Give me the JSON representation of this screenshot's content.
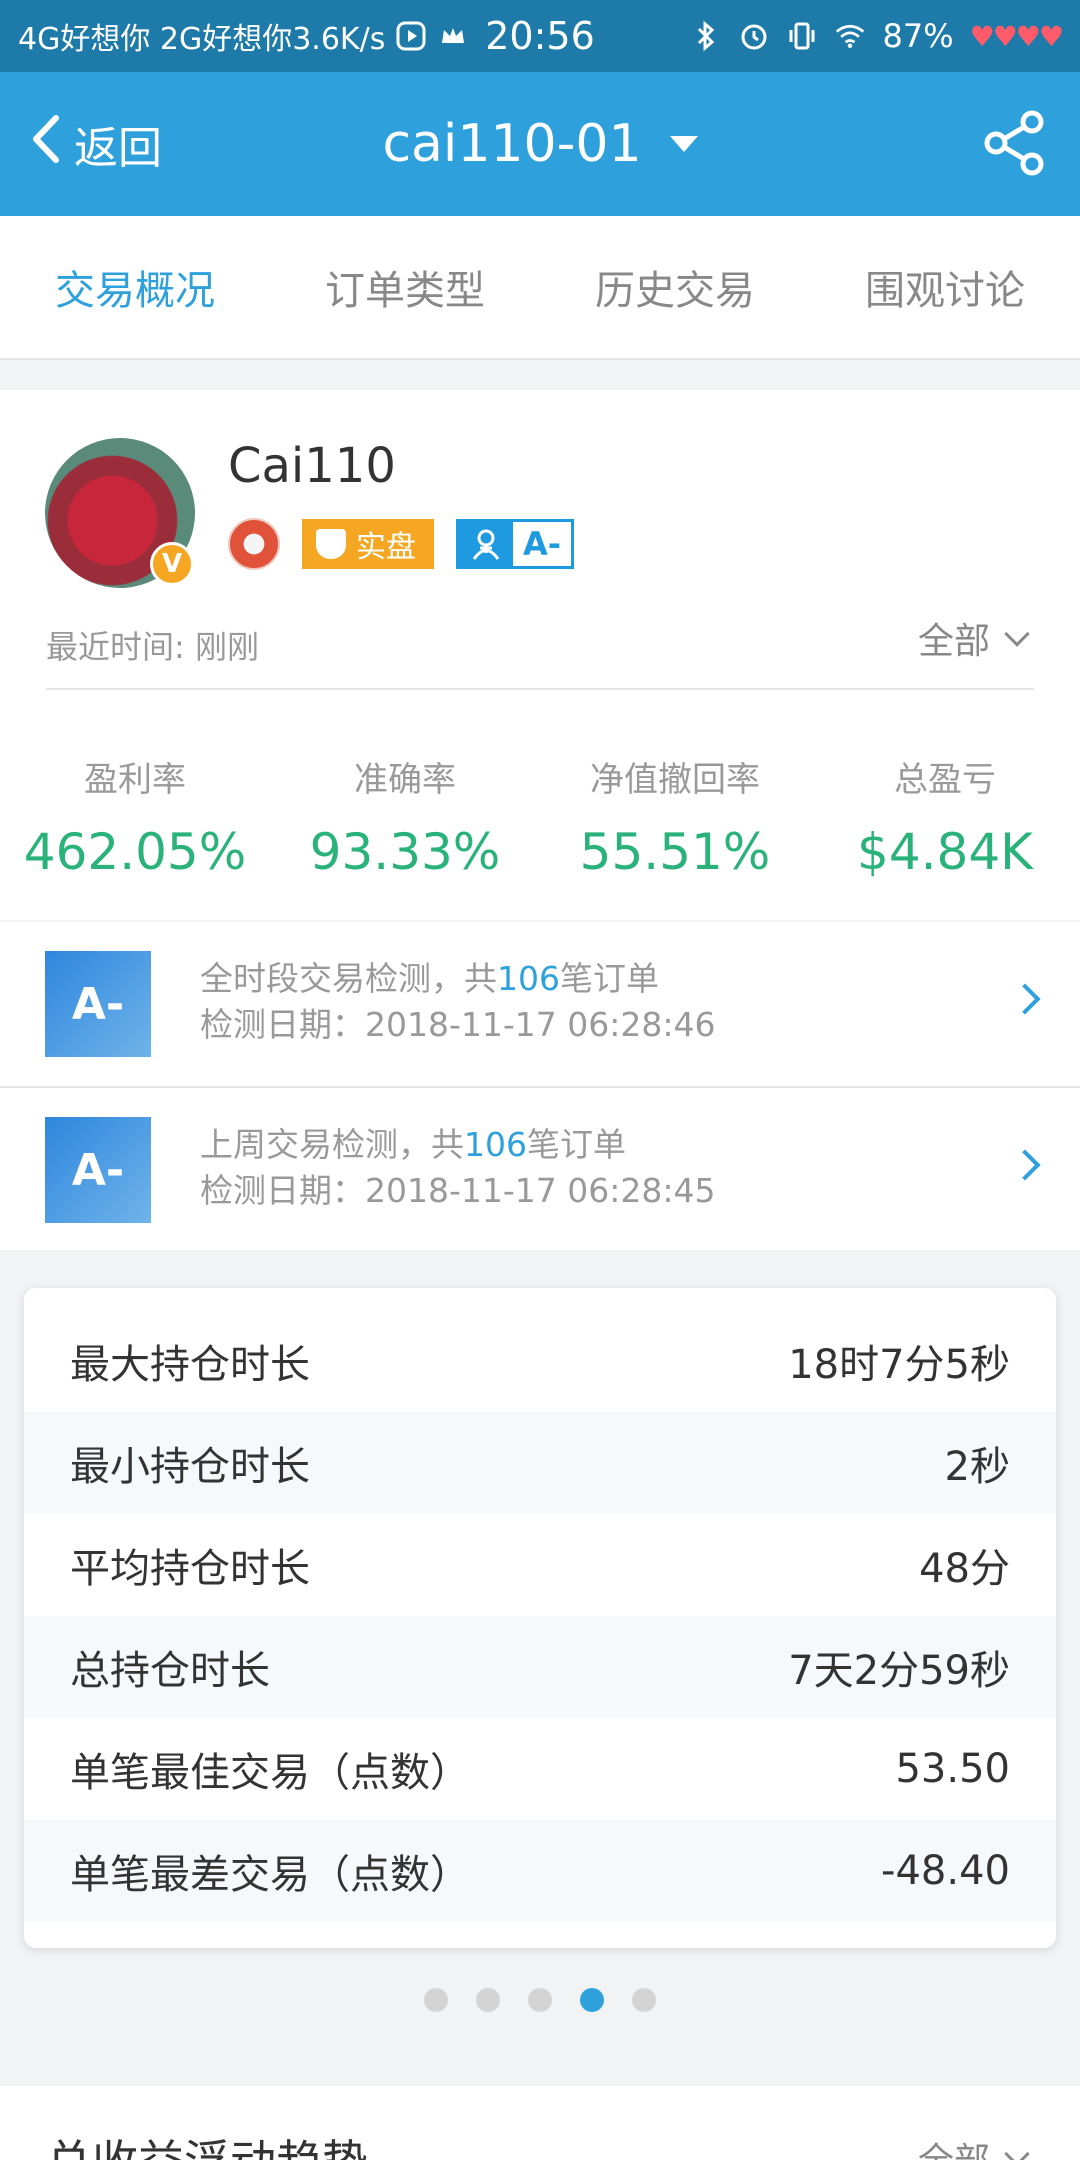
{
  "status_bar": {
    "network": "4G好想你 2G好想你3.6K/s",
    "time": "20:56",
    "battery": "87%"
  },
  "header": {
    "back_label": "返回",
    "title": "cai110-01"
  },
  "tabs": [
    {
      "label": "交易概况",
      "active": true
    },
    {
      "label": "订单类型",
      "active": false
    },
    {
      "label": "历史交易",
      "active": false
    },
    {
      "label": "围观讨论",
      "active": false
    }
  ],
  "profile": {
    "username": "Cai110",
    "avatar_badge": "V",
    "badge_real": "实盘",
    "badge_grade": "A-",
    "recent_time": "最近时间: 刚刚",
    "range": "全部"
  },
  "stats": [
    {
      "label": "盈利率",
      "value": "462.05%"
    },
    {
      "label": "准确率",
      "value": "93.33%"
    },
    {
      "label": "净值撤回率",
      "value": "55.51%"
    },
    {
      "label": "总盈亏",
      "value": "$4.84K"
    }
  ],
  "detections": [
    {
      "grade": "A-",
      "prefix": "全时段交易检测，共",
      "count": "106",
      "suffix": "笔订单",
      "date": "检测日期：2018-11-17 06:28:46"
    },
    {
      "grade": "A-",
      "prefix": "上周交易检测，共",
      "count": "106",
      "suffix": "笔订单",
      "date": "检测日期：2018-11-17 06:28:45"
    }
  ],
  "holding_stats": [
    {
      "label": "最大持仓时长",
      "value": "18时7分5秒"
    },
    {
      "label": "最小持仓时长",
      "value": "2秒"
    },
    {
      "label": "平均持仓时长",
      "value": "48分"
    },
    {
      "label": "总持仓时长",
      "value": "7天2分59秒"
    },
    {
      "label": "单笔最佳交易（点数）",
      "value": "53.50"
    },
    {
      "label": "单笔最差交易（点数）",
      "value": "-48.40"
    }
  ],
  "pager": {
    "count": 5,
    "active_index": 3
  },
  "bottom": {
    "title": "总收益浮动趋势",
    "range": "全部"
  },
  "colors": {
    "header_blue": "#2ea1dc",
    "status_blue": "#1d7aa9",
    "positive_green": "#2ab27b",
    "badge_orange": "#f5a623"
  }
}
